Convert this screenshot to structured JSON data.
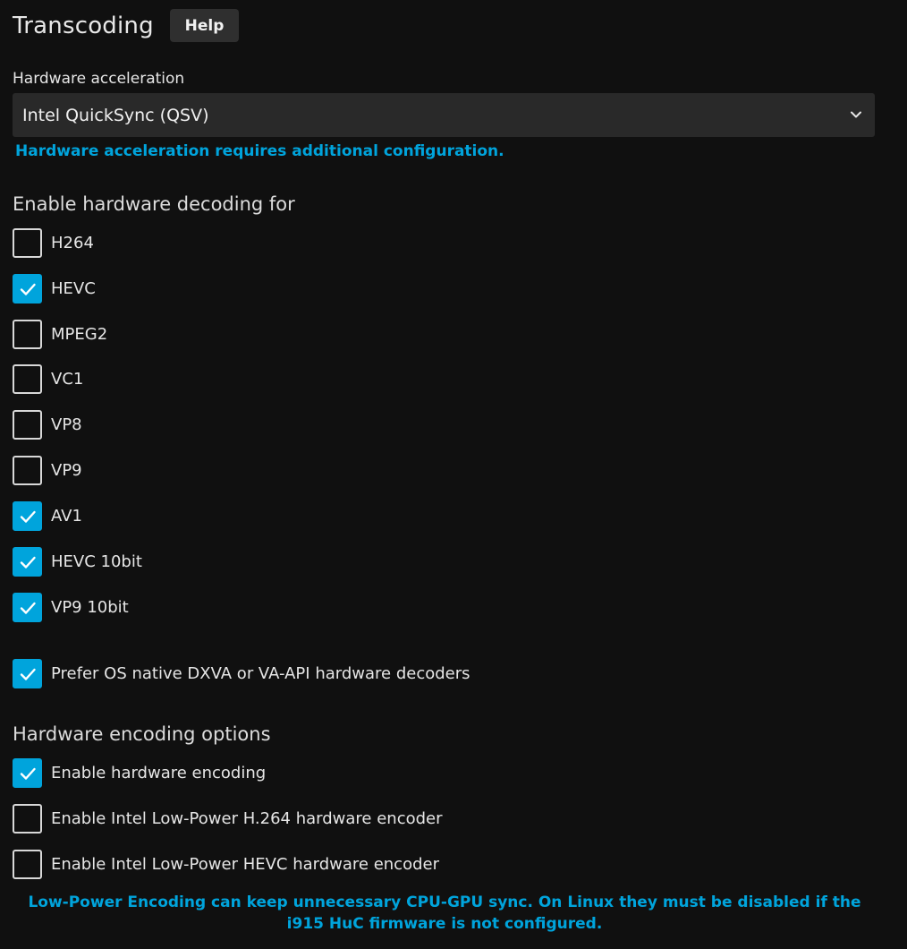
{
  "header": {
    "title": "Transcoding",
    "help_label": "Help"
  },
  "hardware_acceleration": {
    "label": "Hardware acceleration",
    "selected": "Intel QuickSync (QSV)",
    "note": "Hardware acceleration requires additional configuration."
  },
  "decoding": {
    "title": "Enable hardware decoding for",
    "codecs": [
      {
        "label": "H264",
        "checked": false
      },
      {
        "label": "HEVC",
        "checked": true
      },
      {
        "label": "MPEG2",
        "checked": false
      },
      {
        "label": "VC1",
        "checked": false
      },
      {
        "label": "VP8",
        "checked": false
      },
      {
        "label": "VP9",
        "checked": false
      },
      {
        "label": "AV1",
        "checked": true
      },
      {
        "label": "HEVC 10bit",
        "checked": true
      },
      {
        "label": "VP9 10bit",
        "checked": true
      }
    ],
    "prefer_native": {
      "label": "Prefer OS native DXVA or VA-API hardware decoders",
      "checked": true
    }
  },
  "encoding": {
    "title": "Hardware encoding options",
    "options": [
      {
        "label": "Enable hardware encoding",
        "checked": true
      },
      {
        "label": "Enable Intel Low-Power H.264 hardware encoder",
        "checked": false
      },
      {
        "label": "Enable Intel Low-Power HEVC hardware encoder",
        "checked": false
      }
    ],
    "note": "Low-Power Encoding can keep unnecessary CPU-GPU sync. On Linux they must be disabled if the i915 HuC firmware is not configured."
  },
  "colors": {
    "accent": "#00a4dc",
    "background": "#101010",
    "select_background": "#292929",
    "button_background": "#2f2f2f"
  },
  "icons": {
    "select_arrow": "chevron-down-icon",
    "checkbox_mark": "checkmark-icon"
  }
}
